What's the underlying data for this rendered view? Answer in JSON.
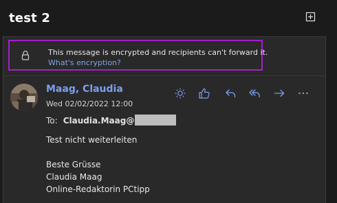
{
  "header": {
    "subject": "test 2"
  },
  "encryption": {
    "message": "This message is encrypted and recipients can't forward it.",
    "link": "What's encryption?"
  },
  "message": {
    "sender": "Maag, Claudia",
    "date": "Wed 02/02/2022 12:00",
    "to_label": "To:",
    "to_name": "Claudia.Maag@",
    "body": [
      "Test nicht weiterleiten",
      "",
      "Beste Grüsse",
      "Claudia Maag",
      "Online-Redaktorin PCtipp"
    ]
  },
  "colors": {
    "accent": "#7c9ff0",
    "highlight_border": "#a320c9",
    "background": "#1b1b1b",
    "pane": "#292929"
  },
  "icons": {
    "actions": [
      "sun-icon",
      "thumbs-up-icon",
      "reply-icon",
      "reply-all-icon",
      "forward-icon",
      "more-icon"
    ],
    "lock": "lock-icon",
    "popout": "popout-icon"
  }
}
